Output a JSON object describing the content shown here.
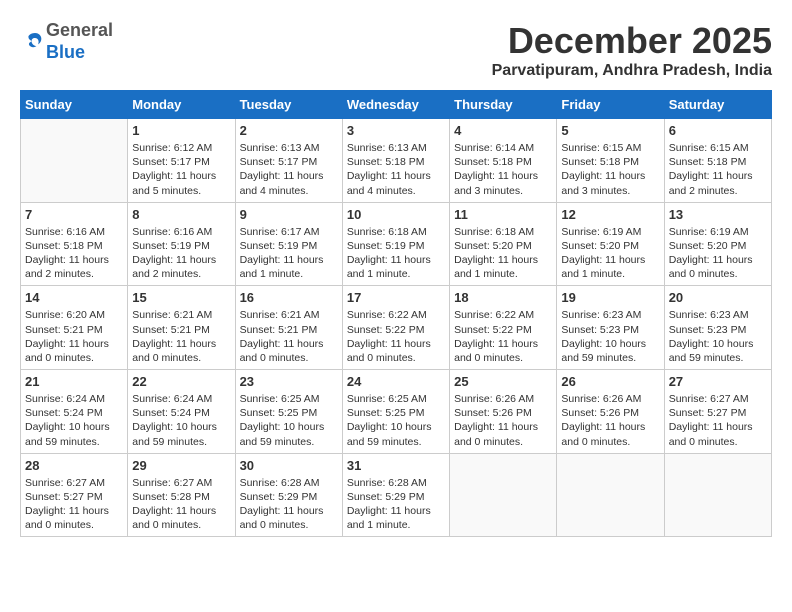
{
  "header": {
    "logo": {
      "line1": "General",
      "line2": "Blue"
    },
    "month": "December 2025",
    "location": "Parvatipuram, Andhra Pradesh, India"
  },
  "calendar": {
    "days_of_week": [
      "Sunday",
      "Monday",
      "Tuesday",
      "Wednesday",
      "Thursday",
      "Friday",
      "Saturday"
    ],
    "weeks": [
      [
        {
          "day": "",
          "sunrise": "",
          "sunset": "",
          "daylight": ""
        },
        {
          "day": "1",
          "sunrise": "Sunrise: 6:12 AM",
          "sunset": "Sunset: 5:17 PM",
          "daylight": "Daylight: 11 hours and 5 minutes."
        },
        {
          "day": "2",
          "sunrise": "Sunrise: 6:13 AM",
          "sunset": "Sunset: 5:17 PM",
          "daylight": "Daylight: 11 hours and 4 minutes."
        },
        {
          "day": "3",
          "sunrise": "Sunrise: 6:13 AM",
          "sunset": "Sunset: 5:18 PM",
          "daylight": "Daylight: 11 hours and 4 minutes."
        },
        {
          "day": "4",
          "sunrise": "Sunrise: 6:14 AM",
          "sunset": "Sunset: 5:18 PM",
          "daylight": "Daylight: 11 hours and 3 minutes."
        },
        {
          "day": "5",
          "sunrise": "Sunrise: 6:15 AM",
          "sunset": "Sunset: 5:18 PM",
          "daylight": "Daylight: 11 hours and 3 minutes."
        },
        {
          "day": "6",
          "sunrise": "Sunrise: 6:15 AM",
          "sunset": "Sunset: 5:18 PM",
          "daylight": "Daylight: 11 hours and 2 minutes."
        }
      ],
      [
        {
          "day": "7",
          "sunrise": "Sunrise: 6:16 AM",
          "sunset": "Sunset: 5:18 PM",
          "daylight": "Daylight: 11 hours and 2 minutes."
        },
        {
          "day": "8",
          "sunrise": "Sunrise: 6:16 AM",
          "sunset": "Sunset: 5:19 PM",
          "daylight": "Daylight: 11 hours and 2 minutes."
        },
        {
          "day": "9",
          "sunrise": "Sunrise: 6:17 AM",
          "sunset": "Sunset: 5:19 PM",
          "daylight": "Daylight: 11 hours and 1 minute."
        },
        {
          "day": "10",
          "sunrise": "Sunrise: 6:18 AM",
          "sunset": "Sunset: 5:19 PM",
          "daylight": "Daylight: 11 hours and 1 minute."
        },
        {
          "day": "11",
          "sunrise": "Sunrise: 6:18 AM",
          "sunset": "Sunset: 5:20 PM",
          "daylight": "Daylight: 11 hours and 1 minute."
        },
        {
          "day": "12",
          "sunrise": "Sunrise: 6:19 AM",
          "sunset": "Sunset: 5:20 PM",
          "daylight": "Daylight: 11 hours and 1 minute."
        },
        {
          "day": "13",
          "sunrise": "Sunrise: 6:19 AM",
          "sunset": "Sunset: 5:20 PM",
          "daylight": "Daylight: 11 hours and 0 minutes."
        }
      ],
      [
        {
          "day": "14",
          "sunrise": "Sunrise: 6:20 AM",
          "sunset": "Sunset: 5:21 PM",
          "daylight": "Daylight: 11 hours and 0 minutes."
        },
        {
          "day": "15",
          "sunrise": "Sunrise: 6:21 AM",
          "sunset": "Sunset: 5:21 PM",
          "daylight": "Daylight: 11 hours and 0 minutes."
        },
        {
          "day": "16",
          "sunrise": "Sunrise: 6:21 AM",
          "sunset": "Sunset: 5:21 PM",
          "daylight": "Daylight: 11 hours and 0 minutes."
        },
        {
          "day": "17",
          "sunrise": "Sunrise: 6:22 AM",
          "sunset": "Sunset: 5:22 PM",
          "daylight": "Daylight: 11 hours and 0 minutes."
        },
        {
          "day": "18",
          "sunrise": "Sunrise: 6:22 AM",
          "sunset": "Sunset: 5:22 PM",
          "daylight": "Daylight: 11 hours and 0 minutes."
        },
        {
          "day": "19",
          "sunrise": "Sunrise: 6:23 AM",
          "sunset": "Sunset: 5:23 PM",
          "daylight": "Daylight: 10 hours and 59 minutes."
        },
        {
          "day": "20",
          "sunrise": "Sunrise: 6:23 AM",
          "sunset": "Sunset: 5:23 PM",
          "daylight": "Daylight: 10 hours and 59 minutes."
        }
      ],
      [
        {
          "day": "21",
          "sunrise": "Sunrise: 6:24 AM",
          "sunset": "Sunset: 5:24 PM",
          "daylight": "Daylight: 10 hours and 59 minutes."
        },
        {
          "day": "22",
          "sunrise": "Sunrise: 6:24 AM",
          "sunset": "Sunset: 5:24 PM",
          "daylight": "Daylight: 10 hours and 59 minutes."
        },
        {
          "day": "23",
          "sunrise": "Sunrise: 6:25 AM",
          "sunset": "Sunset: 5:25 PM",
          "daylight": "Daylight: 10 hours and 59 minutes."
        },
        {
          "day": "24",
          "sunrise": "Sunrise: 6:25 AM",
          "sunset": "Sunset: 5:25 PM",
          "daylight": "Daylight: 10 hours and 59 minutes."
        },
        {
          "day": "25",
          "sunrise": "Sunrise: 6:26 AM",
          "sunset": "Sunset: 5:26 PM",
          "daylight": "Daylight: 11 hours and 0 minutes."
        },
        {
          "day": "26",
          "sunrise": "Sunrise: 6:26 AM",
          "sunset": "Sunset: 5:26 PM",
          "daylight": "Daylight: 11 hours and 0 minutes."
        },
        {
          "day": "27",
          "sunrise": "Sunrise: 6:27 AM",
          "sunset": "Sunset: 5:27 PM",
          "daylight": "Daylight: 11 hours and 0 minutes."
        }
      ],
      [
        {
          "day": "28",
          "sunrise": "Sunrise: 6:27 AM",
          "sunset": "Sunset: 5:27 PM",
          "daylight": "Daylight: 11 hours and 0 minutes."
        },
        {
          "day": "29",
          "sunrise": "Sunrise: 6:27 AM",
          "sunset": "Sunset: 5:28 PM",
          "daylight": "Daylight: 11 hours and 0 minutes."
        },
        {
          "day": "30",
          "sunrise": "Sunrise: 6:28 AM",
          "sunset": "Sunset: 5:29 PM",
          "daylight": "Daylight: 11 hours and 0 minutes."
        },
        {
          "day": "31",
          "sunrise": "Sunrise: 6:28 AM",
          "sunset": "Sunset: 5:29 PM",
          "daylight": "Daylight: 11 hours and 1 minute."
        },
        {
          "day": "",
          "sunrise": "",
          "sunset": "",
          "daylight": ""
        },
        {
          "day": "",
          "sunrise": "",
          "sunset": "",
          "daylight": ""
        },
        {
          "day": "",
          "sunrise": "",
          "sunset": "",
          "daylight": ""
        }
      ]
    ]
  }
}
